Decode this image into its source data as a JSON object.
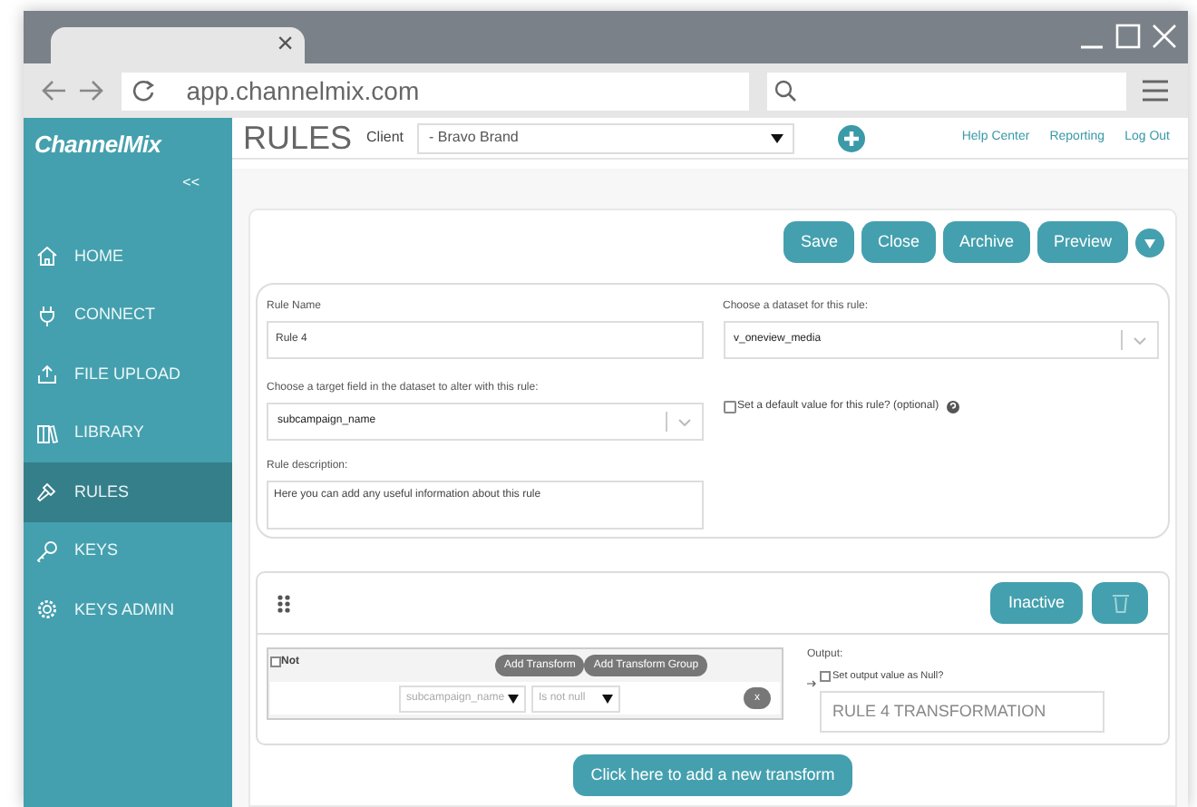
{
  "browser": {
    "tab_close": "×",
    "url": "app.channelmix.com"
  },
  "sidebar": {
    "logo": "ChannelMix",
    "collapse": "<<",
    "items": [
      {
        "label": "HOME",
        "selected": false
      },
      {
        "label": "CONNECT",
        "selected": false
      },
      {
        "label": "FILE UPLOAD",
        "selected": false
      },
      {
        "label": "LIBRARY",
        "selected": false
      },
      {
        "label": "RULES",
        "selected": true
      },
      {
        "label": "KEYS",
        "selected": false
      },
      {
        "label": "KEYS ADMIN",
        "selected": false
      }
    ]
  },
  "header": {
    "title": "RULES",
    "client_label": "Client",
    "client_value": "- Bravo Brand",
    "links": [
      "Help Center",
      "Reporting",
      "Log Out"
    ]
  },
  "actions": [
    "Save",
    "Close",
    "Archive",
    "Preview"
  ],
  "form": {
    "rule_name": {
      "label": "Rule Name",
      "value": "Rule 4"
    },
    "dataset": {
      "label": "Choose a dataset for this rule:",
      "value": "v_oneview_media"
    },
    "target_field": {
      "label": "Choose a target field in the dataset to alter with this rule:",
      "value": "subcampaign_name"
    },
    "default_value": {
      "label": "Set a default value for this rule? (optional)",
      "checked": false
    },
    "description": {
      "label": "Rule description:",
      "value": "Here you can add any useful information about this rule"
    }
  },
  "transform": {
    "status": "Inactive",
    "not": {
      "label": "Not",
      "checked": false
    },
    "buttons": [
      "Add Transform",
      "Add Transform Group"
    ],
    "condition": {
      "field": "subcampaign_name",
      "operator": "Is not null",
      "remove": "x"
    },
    "output": {
      "label": "Output:",
      "null_option": {
        "label": "Set output value as Null?",
        "checked": false
      },
      "placeholder": "RULE 4 TRANSFORMATION"
    }
  },
  "add_button": "Click here to add a new transform"
}
